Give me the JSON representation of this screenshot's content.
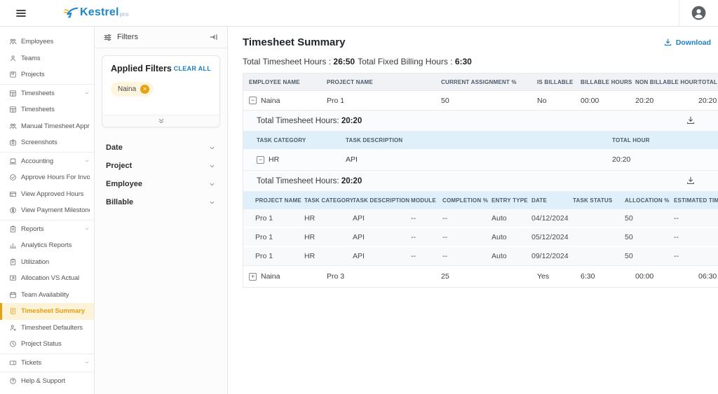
{
  "topbar": {
    "brand": "Kestrel",
    "brand_suffix": "pro"
  },
  "colors": {
    "accent_blue": "#1b7fc2",
    "accent_gold": "#e5a413",
    "subheader_blue": "#e0f0fa",
    "active_bg": "#fdf3d8"
  },
  "sidebar": {
    "items": [
      {
        "label": "Employees",
        "icon": "employees"
      },
      {
        "label": "Teams",
        "icon": "teams"
      },
      {
        "label": "Projects",
        "icon": "projects",
        "divider_after": true
      },
      {
        "label": "Timesheets",
        "icon": "timesheets",
        "expandable": true
      },
      {
        "label": "Timesheets",
        "icon": "timesheets"
      },
      {
        "label": "Manual Timesheet Approval",
        "icon": "manual-approval"
      },
      {
        "label": "Screenshots",
        "icon": "screenshots",
        "divider_after": true
      },
      {
        "label": "Accounting",
        "icon": "accounting",
        "expandable": true
      },
      {
        "label": "Approve Hours For Invoicing",
        "icon": "approve-invoicing"
      },
      {
        "label": "View Approved Hours",
        "icon": "approved-hours"
      },
      {
        "label": "View Payment Milestones",
        "icon": "payment-milestones",
        "divider_after": true
      },
      {
        "label": "Reports",
        "icon": "reports",
        "expandable": true
      },
      {
        "label": "Analytics Reports",
        "icon": "analytics"
      },
      {
        "label": "Utilization",
        "icon": "utilization"
      },
      {
        "label": "Allocation VS Actual",
        "icon": "allocation"
      },
      {
        "label": "Team Availability",
        "icon": "availability"
      },
      {
        "label": "Timesheet Summary",
        "icon": "summary",
        "active": true
      },
      {
        "label": "Timesheet Defaulters",
        "icon": "defaulters"
      },
      {
        "label": "Project Status",
        "icon": "status",
        "divider_after": true
      },
      {
        "label": "Tickets",
        "icon": "tickets",
        "expandable": true,
        "divider_after": true
      },
      {
        "label": "Help & Support",
        "icon": "help"
      }
    ]
  },
  "filters": {
    "title": "Filters",
    "applied_title": "Applied Filters",
    "clear_all": "CLEAR ALL",
    "chips": [
      "Naina"
    ],
    "sections": [
      "Date",
      "Project",
      "Employee",
      "Billable"
    ]
  },
  "main": {
    "title": "Timesheet Summary",
    "download_label": "Download",
    "totals": [
      {
        "label": "Total Timesheet Hours :",
        "value": "26:50"
      },
      {
        "label": "Total Fixed Billing Hours :",
        "value": "6:30"
      }
    ],
    "summary_table": {
      "columns": [
        "EMPLOYEE NAME",
        "PROJECT NAME",
        "CURRENT ASSIGNMENT %",
        "IS BILLABLE",
        "BILLABLE HOURS",
        "NON BILLABLE HOURS",
        "TOTAL HOURS"
      ],
      "rows": [
        {
          "expanded": true,
          "cells": [
            "Naina",
            "Pro 1",
            "50",
            "No",
            "00:00",
            "20:20",
            "20:20"
          ]
        },
        {
          "expanded": false,
          "cells": [
            "Naina",
            "Pro 3",
            "25",
            "Yes",
            "6:30",
            "00:00",
            "06:30"
          ]
        }
      ],
      "category_panel": {
        "total_label": "Total Timesheet Hours:",
        "total_value": "20:20",
        "columns": [
          "TASK CATEGORY",
          "TASK DESCRIPTION",
          "TOTAL HOUR"
        ],
        "rows": [
          {
            "expanded": true,
            "cells": [
              "HR",
              "API",
              "20:20"
            ]
          }
        ]
      },
      "detail_panel": {
        "total_label": "Total Timesheet Hours:",
        "total_value": "20:20",
        "columns": [
          "PROJECT NAME",
          "TASK CATEGORY",
          "TASK DESCRIPTION",
          "MODULE",
          "COMPLETION %",
          "ENTRY TYPE",
          "DATE",
          "TASK STATUS",
          "ALLOCATION %",
          "ESTIMATED TIME"
        ],
        "rows": [
          [
            "Pro 1",
            "HR",
            "API",
            "--",
            "--",
            "Auto",
            "04/12/2024",
            "",
            "50",
            "--"
          ],
          [
            "Pro 1",
            "HR",
            "API",
            "--",
            "--",
            "Auto",
            "05/12/2024",
            "",
            "50",
            "--"
          ],
          [
            "Pro 1",
            "HR",
            "API",
            "--",
            "--",
            "Auto",
            "09/12/2024",
            "",
            "50",
            "--"
          ]
        ]
      }
    }
  }
}
